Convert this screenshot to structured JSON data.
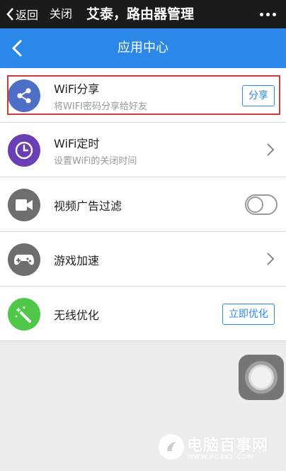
{
  "topbar": {
    "back_label": "返回",
    "close_label": "关闭",
    "title": "艾泰，路由器管理"
  },
  "header": {
    "title": "应用中心"
  },
  "items": [
    {
      "title": "WiFi分享",
      "subtitle": "将WIFI密码分享给好友",
      "action": "分享",
      "icon": "share-icon",
      "icon_color": "#4d6fc6",
      "highlighted": true
    },
    {
      "title": "WiFi定时",
      "subtitle": "设置WiFi的关闭时间",
      "icon": "clock-icon",
      "icon_color": "#6a3fb5"
    },
    {
      "title": "视频广告过滤",
      "icon": "video-camera-icon",
      "icon_color": "#6e6e6e",
      "toggle_on": false
    },
    {
      "title": "游戏加速",
      "icon": "gamepad-icon",
      "icon_color": "#6e6e6e"
    },
    {
      "title": "无线优化",
      "action": "立即优化",
      "icon": "magic-wand-icon",
      "icon_color": "#4fc84a"
    }
  ],
  "watermark": {
    "main": "电脑百事网",
    "url": "WWW.PC841.COM"
  },
  "colors": {
    "topbar": "#1b1b1b",
    "header": "#2c88e8",
    "accent": "#2c88e8",
    "highlight_border": "#d23b3b"
  }
}
